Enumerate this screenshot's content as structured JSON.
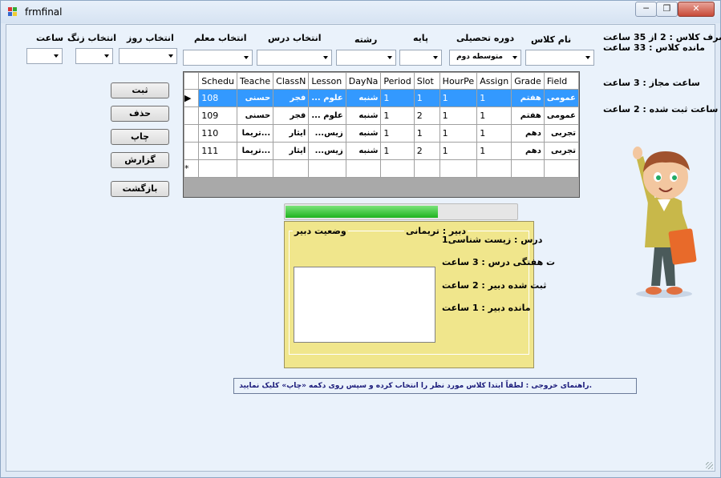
{
  "window": {
    "title": "frmfinal",
    "minimize_glyph": "─",
    "maximize_glyph": "❐",
    "close_glyph": "✕"
  },
  "filters": {
    "class_name": {
      "label": "نام کلاس",
      "value": ""
    },
    "education_period": {
      "label": "دوره تحصیلی",
      "value": "متوسطه دوم"
    },
    "grade": {
      "label": "پایه",
      "value": ""
    },
    "field": {
      "label": "رشته",
      "value": ""
    },
    "lesson": {
      "label": "انتخاب درس",
      "value": ""
    },
    "teacher": {
      "label": "انتخاب معلم",
      "value": ""
    },
    "day": {
      "label": "انتخاب روز",
      "value": ""
    },
    "bell": {
      "label": "انتخاب زنگ",
      "value": ""
    },
    "hour": {
      "label": "ساعت",
      "value": ""
    }
  },
  "class_status": {
    "used": "مصرف کلاس : 2 از 35 ساعت",
    "remaining": "مانده کلاس : 33 ساعت",
    "allowed": "ساعت مجاز : 3 ساعت",
    "registered": "ساعت ثبت شده : 2 ساعت"
  },
  "buttons": {
    "save": "ثبت",
    "delete": "حذف",
    "print": "چاپ",
    "report": "گزارش",
    "back": "بازگشت"
  },
  "grid": {
    "columns": [
      "Schedu",
      "Teache",
      "ClassN",
      "Lesson",
      "DayNa",
      "Period",
      "Slot",
      "HourPe",
      "Assign",
      "Grade",
      "Field"
    ],
    "rows": [
      [
        "108",
        "حسنی",
        "فجر",
        "علوم ...",
        "شنبه",
        "1",
        "1",
        "1",
        "1",
        "هفتم",
        "عمومی"
      ],
      [
        "109",
        "حسنی",
        "فجر",
        "علوم ...",
        "شنبه",
        "1",
        "2",
        "1",
        "1",
        "هفتم",
        "عمومی"
      ],
      [
        "110",
        "...تریما",
        "ایثار",
        "زیس...",
        "شنبه",
        "1",
        "1",
        "1",
        "1",
        "دهم",
        "تجربی"
      ],
      [
        "111",
        "...تریما",
        "ایثار",
        "زیس...",
        "شنبه",
        "1",
        "2",
        "1",
        "1",
        "دهم",
        "تجربی"
      ]
    ],
    "selected_row": 0,
    "current_row_marker": "▶",
    "new_row_marker": "*"
  },
  "progress": {
    "value": 0.66
  },
  "teacher_panel": {
    "status_title": "وضعیت دبیر",
    "teacher_line": "دبیر : تریمانی",
    "lesson_line": "درس : زیست شناسی1",
    "weekly_hours": "ت هفتگی درس : 3 ساعت",
    "registered_hours": "ثبت شده دبیر : 2 ساعت",
    "remaining_hours": "مانده دبیر : 1 ساعت"
  },
  "hint": ".راهنمای خروجی : لطفاً ابتدا کلاس مورد نظر را انتخاب کرده و سپس روی دکمه «چاپ» کلیک نمایید",
  "colors": {
    "window_bg": "#eaf2fb",
    "selection": "#3399ff",
    "panel": "#f0e68c",
    "progress": "#1fb31f"
  },
  "illustration": "boy-teacher-cartoon"
}
